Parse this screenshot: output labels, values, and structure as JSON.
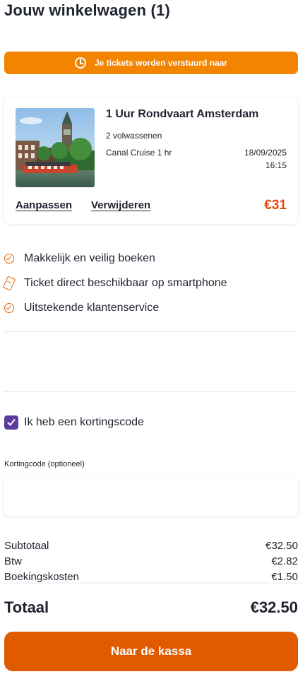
{
  "page": {
    "title": "Jouw winkelwagen (1)"
  },
  "banner": {
    "text": "Je tickets worden verstuurd naar",
    "icon": "clock-icon",
    "color": "#f28400"
  },
  "cart_item": {
    "title": "1 Uur Rondvaart Amsterdam",
    "persons": "2 volwassenen",
    "option": "Canal Cruise 1 hr",
    "date": "18/09/2025",
    "time": "16:15",
    "edit_label": "Aanpassen",
    "remove_label": "Verwijderen",
    "price": "€31",
    "price_color": "#e34a10"
  },
  "usps": [
    {
      "icon": "check-circle-icon",
      "text": "Makkelijk en veilig boeken"
    },
    {
      "icon": "ticket-icon",
      "text": "Ticket direct beschikbaar op smartphone"
    },
    {
      "icon": "check-circle-icon",
      "text": "Uitstekende klantenservice"
    }
  ],
  "discount": {
    "toggle_label": "Ik heb een kortingscode",
    "checked": true,
    "field_label": "Kortingcode (optioneel)",
    "value": "",
    "placeholder": ""
  },
  "summary": {
    "subtotal_label": "Subtotaal",
    "subtotal_value": "€32.50",
    "vat_label": "Btw",
    "vat_value": "€2.82",
    "fee_label": "Boekingskosten",
    "fee_value": "€1.50"
  },
  "total": {
    "label": "Totaal",
    "value": "€32.50"
  },
  "checkout": {
    "label": "Naar de kassa",
    "color": "#e05a00"
  },
  "accent_color": "#5b3d9e"
}
